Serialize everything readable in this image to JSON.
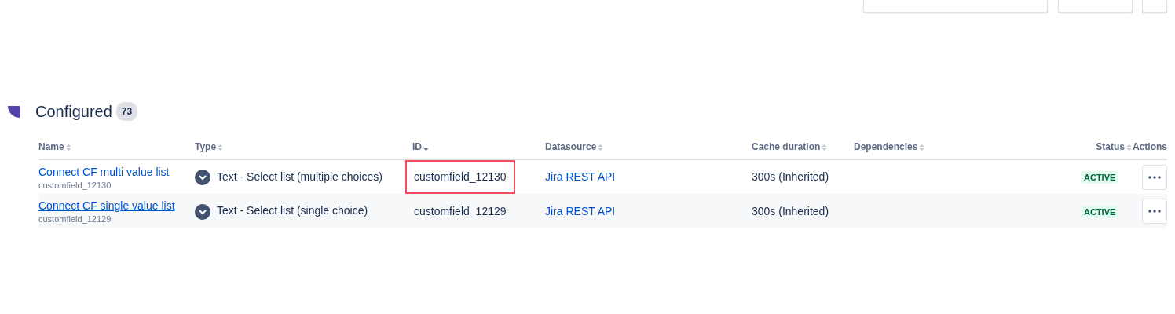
{
  "section": {
    "title": "Configured",
    "count": "73"
  },
  "table": {
    "columns": [
      {
        "label": "Name",
        "sorted": false
      },
      {
        "label": "Type",
        "sorted": false
      },
      {
        "label": "ID",
        "sorted": true
      },
      {
        "label": "Datasource",
        "sorted": false
      },
      {
        "label": "Cache duration",
        "sorted": false
      },
      {
        "label": "Dependencies",
        "sorted": false
      },
      {
        "label": "Status",
        "sorted": false
      },
      {
        "label": "Actions"
      }
    ],
    "rows": [
      {
        "name": "Connect CF multi value list",
        "key": "customfield_12130",
        "type": "Text - Select list (multiple choices)",
        "id": "customfield_12130",
        "id_highlighted": true,
        "datasource": "Jira REST API",
        "cache": "300s (Inherited)",
        "status": "ACTIVE",
        "hovered": false
      },
      {
        "name": "Connect CF single value list",
        "key": "customfield_12129",
        "type": "Text - Select list (single choice)",
        "id": "customfield_12129",
        "id_highlighted": false,
        "datasource": "Jira REST API",
        "cache": "300s (Inherited)",
        "status": "ACTIVE",
        "hovered": true
      }
    ]
  }
}
